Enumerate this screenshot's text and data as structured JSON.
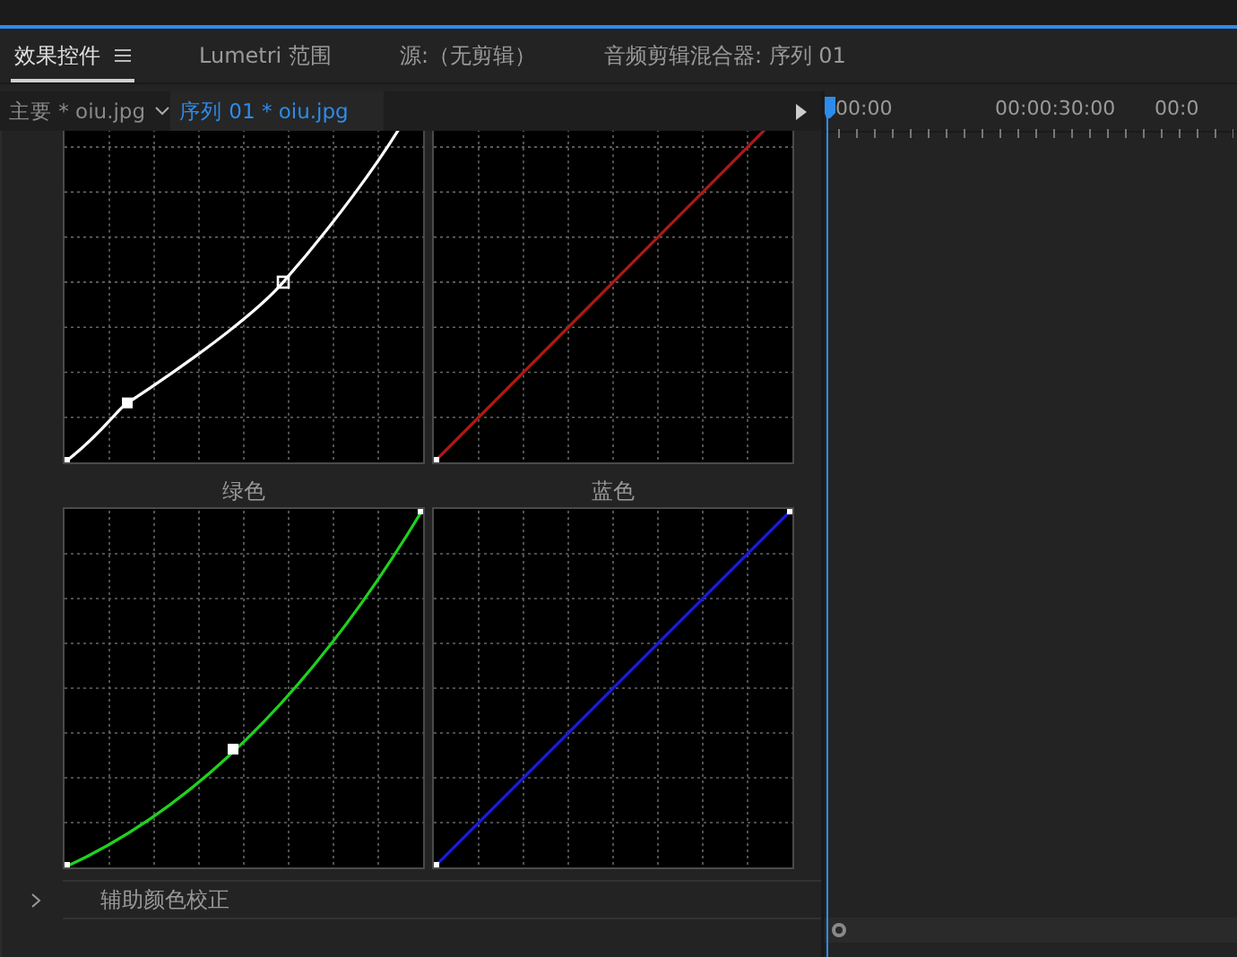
{
  "panel_tabs": [
    {
      "label": "效果控件",
      "selected": true
    },
    {
      "label": "Lumetri 范围",
      "selected": false
    },
    {
      "label": "源:（无剪辑）",
      "selected": false
    },
    {
      "label": "音频剪辑混合器: 序列 01",
      "selected": false
    }
  ],
  "clip_tabs": [
    {
      "label": "主要 * oiu.jpg",
      "selected": false
    },
    {
      "label": "序列 01 * oiu.jpg",
      "selected": true
    }
  ],
  "curves": [
    {
      "color": "#ffffff",
      "kind": "scurve",
      "cut_top": true
    },
    {
      "color": "#b01818",
      "kind": "linear",
      "cut_top": true
    },
    {
      "label": "绿色",
      "color": "#1ed21e",
      "kind": "bowed",
      "cut_top": false
    },
    {
      "label": "蓝色",
      "color": "#1a1ae6",
      "kind": "linear",
      "cut_top": false
    }
  ],
  "section": {
    "label": "辅助颜色校正",
    "expanded": false
  },
  "timeline": {
    "ticks": [
      "00:00",
      "00:00:30:00",
      "00:0"
    ]
  }
}
